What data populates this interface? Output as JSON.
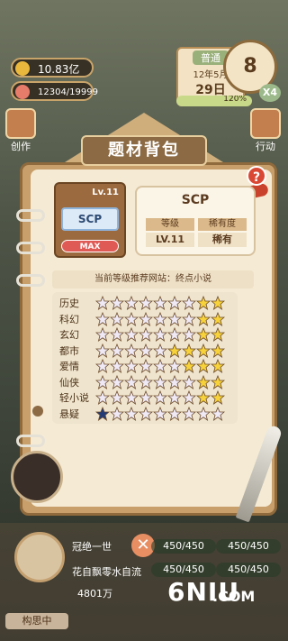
{
  "hud": {
    "coins": "10.83亿",
    "energy": "12304/19999",
    "tag": "普通",
    "month": "12年5月",
    "day": "29日",
    "clock_value": "8",
    "speed": "X4",
    "progress_label": "120%",
    "progress_fraction": 1.0
  },
  "side": {
    "left_label": "创作",
    "right_label": "行动"
  },
  "panel": {
    "title": "题材背包",
    "help": "?",
    "card": {
      "level": "Lv.11",
      "name": "SCP",
      "max": "MAX"
    },
    "info": {
      "name": "SCP",
      "level_header": "等级",
      "rarity_header": "稀有度",
      "level_value": "LV.11",
      "rarity_value": "稀有"
    },
    "recommend": "当前等级推荐网站：终点小说"
  },
  "genres": [
    {
      "name": "历史",
      "stars": [
        0,
        0,
        0,
        0,
        0,
        0,
        0,
        1,
        1
      ]
    },
    {
      "name": "科幻",
      "stars": [
        0,
        0,
        0,
        0,
        0,
        0,
        0,
        1,
        1
      ]
    },
    {
      "name": "玄幻",
      "stars": [
        0,
        0,
        0,
        0,
        0,
        0,
        0,
        1,
        1
      ]
    },
    {
      "name": "都市",
      "stars": [
        0,
        0,
        0,
        0,
        0,
        1,
        1,
        1,
        1
      ]
    },
    {
      "name": "爱情",
      "stars": [
        0,
        0,
        0,
        0,
        0,
        0,
        1,
        1,
        1
      ]
    },
    {
      "name": "仙侠",
      "stars": [
        0,
        0,
        0,
        0,
        0,
        0,
        0,
        1,
        1
      ]
    },
    {
      "name": "轻小说",
      "stars": [
        0,
        0,
        0,
        0,
        0,
        0,
        0,
        1,
        1
      ]
    },
    {
      "name": "悬疑",
      "stars": [
        2,
        0,
        0,
        0,
        0,
        0,
        0,
        0,
        0
      ]
    }
  ],
  "colors": {
    "star_empty": "#efe9f6",
    "star_gold": "#f7d23a",
    "star_navy": "#233c78"
  },
  "bottom": {
    "name1": "冠绝一世",
    "name2": "花自飘零水自流",
    "stat1": "450/450",
    "stat2": "450/450",
    "stat3": "450/450",
    "stat4": "450/450",
    "money": "4801万",
    "side_label": "构思中",
    "close": "✕",
    "watermark": "6NIU",
    "watermark2": ".COM"
  }
}
